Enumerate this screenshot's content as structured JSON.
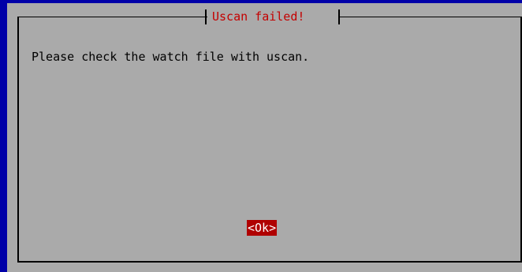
{
  "dialog": {
    "title": "Uscan failed!",
    "message": "Please check the watch file with uscan.",
    "ok_label": "<Ok>"
  },
  "colors": {
    "screen_background": "#0000a8",
    "dialog_background": "#aaaaaa",
    "title_text": "#c40000",
    "button_background": "#b00000",
    "button_text": "#ffffff"
  }
}
